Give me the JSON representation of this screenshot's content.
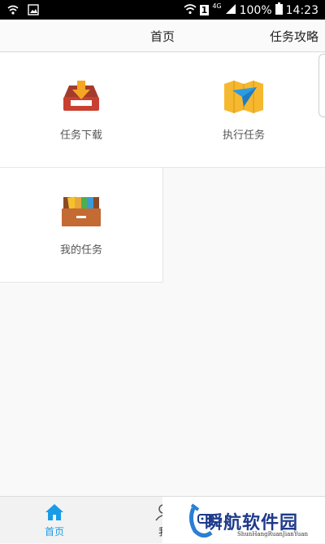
{
  "status_bar": {
    "sim": "1",
    "network": "4G",
    "battery": "100%",
    "time": "14:23"
  },
  "header": {
    "title": "首页",
    "right_link": "任务攻略"
  },
  "grid": [
    {
      "label": "任务下载",
      "icon": "download-tray-icon"
    },
    {
      "label": "执行任务",
      "icon": "map-navigation-icon"
    },
    {
      "label": "我的任务",
      "icon": "drawer-icon"
    }
  ],
  "tabbar": {
    "home_label": "首页",
    "profile_label": "我",
    "active_color": "#1a9be6"
  },
  "watermark": {
    "title": "瞬航软件园",
    "subtitle": "ShunHangRuanJianYuan"
  }
}
